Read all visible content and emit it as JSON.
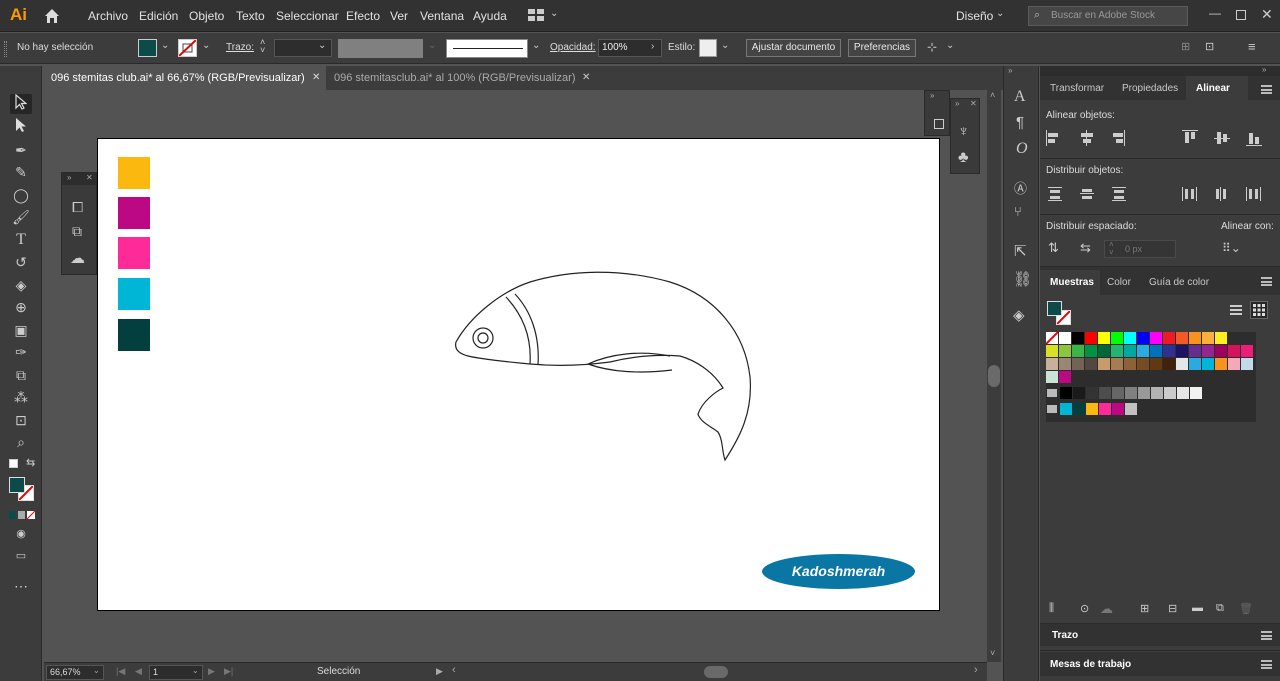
{
  "app": {
    "logo": "Ai",
    "home_icon": "home-icon"
  },
  "menu": [
    "Archivo",
    "Edición",
    "Objeto",
    "Texto",
    "Seleccionar",
    "Efecto",
    "Ver",
    "Ventana",
    "Ayuda"
  ],
  "workspace": {
    "label": "Diseño"
  },
  "stock_search": {
    "placeholder": "Buscar en Adobe Stock"
  },
  "control": {
    "selection_status": "No hay selección",
    "stroke_label": "Trazo:",
    "opacity_label": "Opacidad:",
    "opacity_value": "100%",
    "style_label": "Estilo:",
    "doc_setup_button": "Ajustar documento",
    "prefs_button": "Preferencias",
    "fill_color": "#0d4a4a"
  },
  "tabs": [
    {
      "label": "096 stemitas club.ai* al 66,67% (RGB/Previsualizar)",
      "active": true
    },
    {
      "label": "096 stemitasclub.ai* al 100% (RGB/Previsualizar)",
      "active": false
    }
  ],
  "artboard_swatches": [
    "#fbb90f",
    "#bd0883",
    "#fd2a97",
    "#00b6d6",
    "#023f3e"
  ],
  "watermark": {
    "text": "Kadoshmerah",
    "color": "#0a76a3"
  },
  "status": {
    "zoom": "66,67%",
    "page": "1",
    "tool": "Selección"
  },
  "panel_tabs": [
    "Transformar",
    "Propiedades",
    "Alinear"
  ],
  "align": {
    "align_objects": "Alinear objetos:",
    "distribute_objects": "Distribuir objetos:",
    "distribute_spacing": "Distribuir espaciado:",
    "align_to": "Alinear con:",
    "spacing_value": "0 px"
  },
  "swatch_tabs": [
    "Muestras",
    "Color",
    "Guía de color"
  ],
  "swatch_rows": [
    [
      "none",
      "#ffffff",
      "#000000",
      "#ff0000",
      "#ffff00",
      "#00ff00",
      "#00ffff",
      "#0000ff",
      "#ff00ff",
      "#ed1c24",
      "#f15a24",
      "#f7931e",
      "#fbb03b",
      "#fcee21"
    ],
    [
      "#d9e021",
      "#8cc63f",
      "#39b54a",
      "#009245",
      "#006837",
      "#22b573",
      "#00a99d",
      "#29abe2",
      "#0071bc",
      "#2e3192",
      "#1b1464",
      "#662d91",
      "#93278f",
      "#9e005d",
      "#d4145a",
      "#ed1e79"
    ],
    [
      "#c7b299",
      "#998675",
      "#736357",
      "#534741",
      "#c69c6d",
      "#a67c52",
      "#8c6239",
      "#754c24",
      "#603813",
      "#42210b",
      "#e6e6e6",
      "#29abe2",
      "#00b6d6",
      "#f7931e",
      "#f5a9b8",
      "#c1d9e8"
    ],
    [
      "#c9e4d6",
      "#bd0883"
    ],
    [
      "#000000",
      "#1a1a1a",
      "#333333",
      "#4d4d4d",
      "#666666",
      "#808080",
      "#999999",
      "#b3b3b3",
      "#cccccc",
      "#e6e6e6",
      "#f2f2f2"
    ],
    [
      "#00b6d6",
      "#023f3e",
      "#fbb90f",
      "#fd2a97",
      "#bd0883",
      "#c1c1c1"
    ]
  ],
  "bottom_panels": [
    "Trazo",
    "Mesas de trabajo"
  ]
}
